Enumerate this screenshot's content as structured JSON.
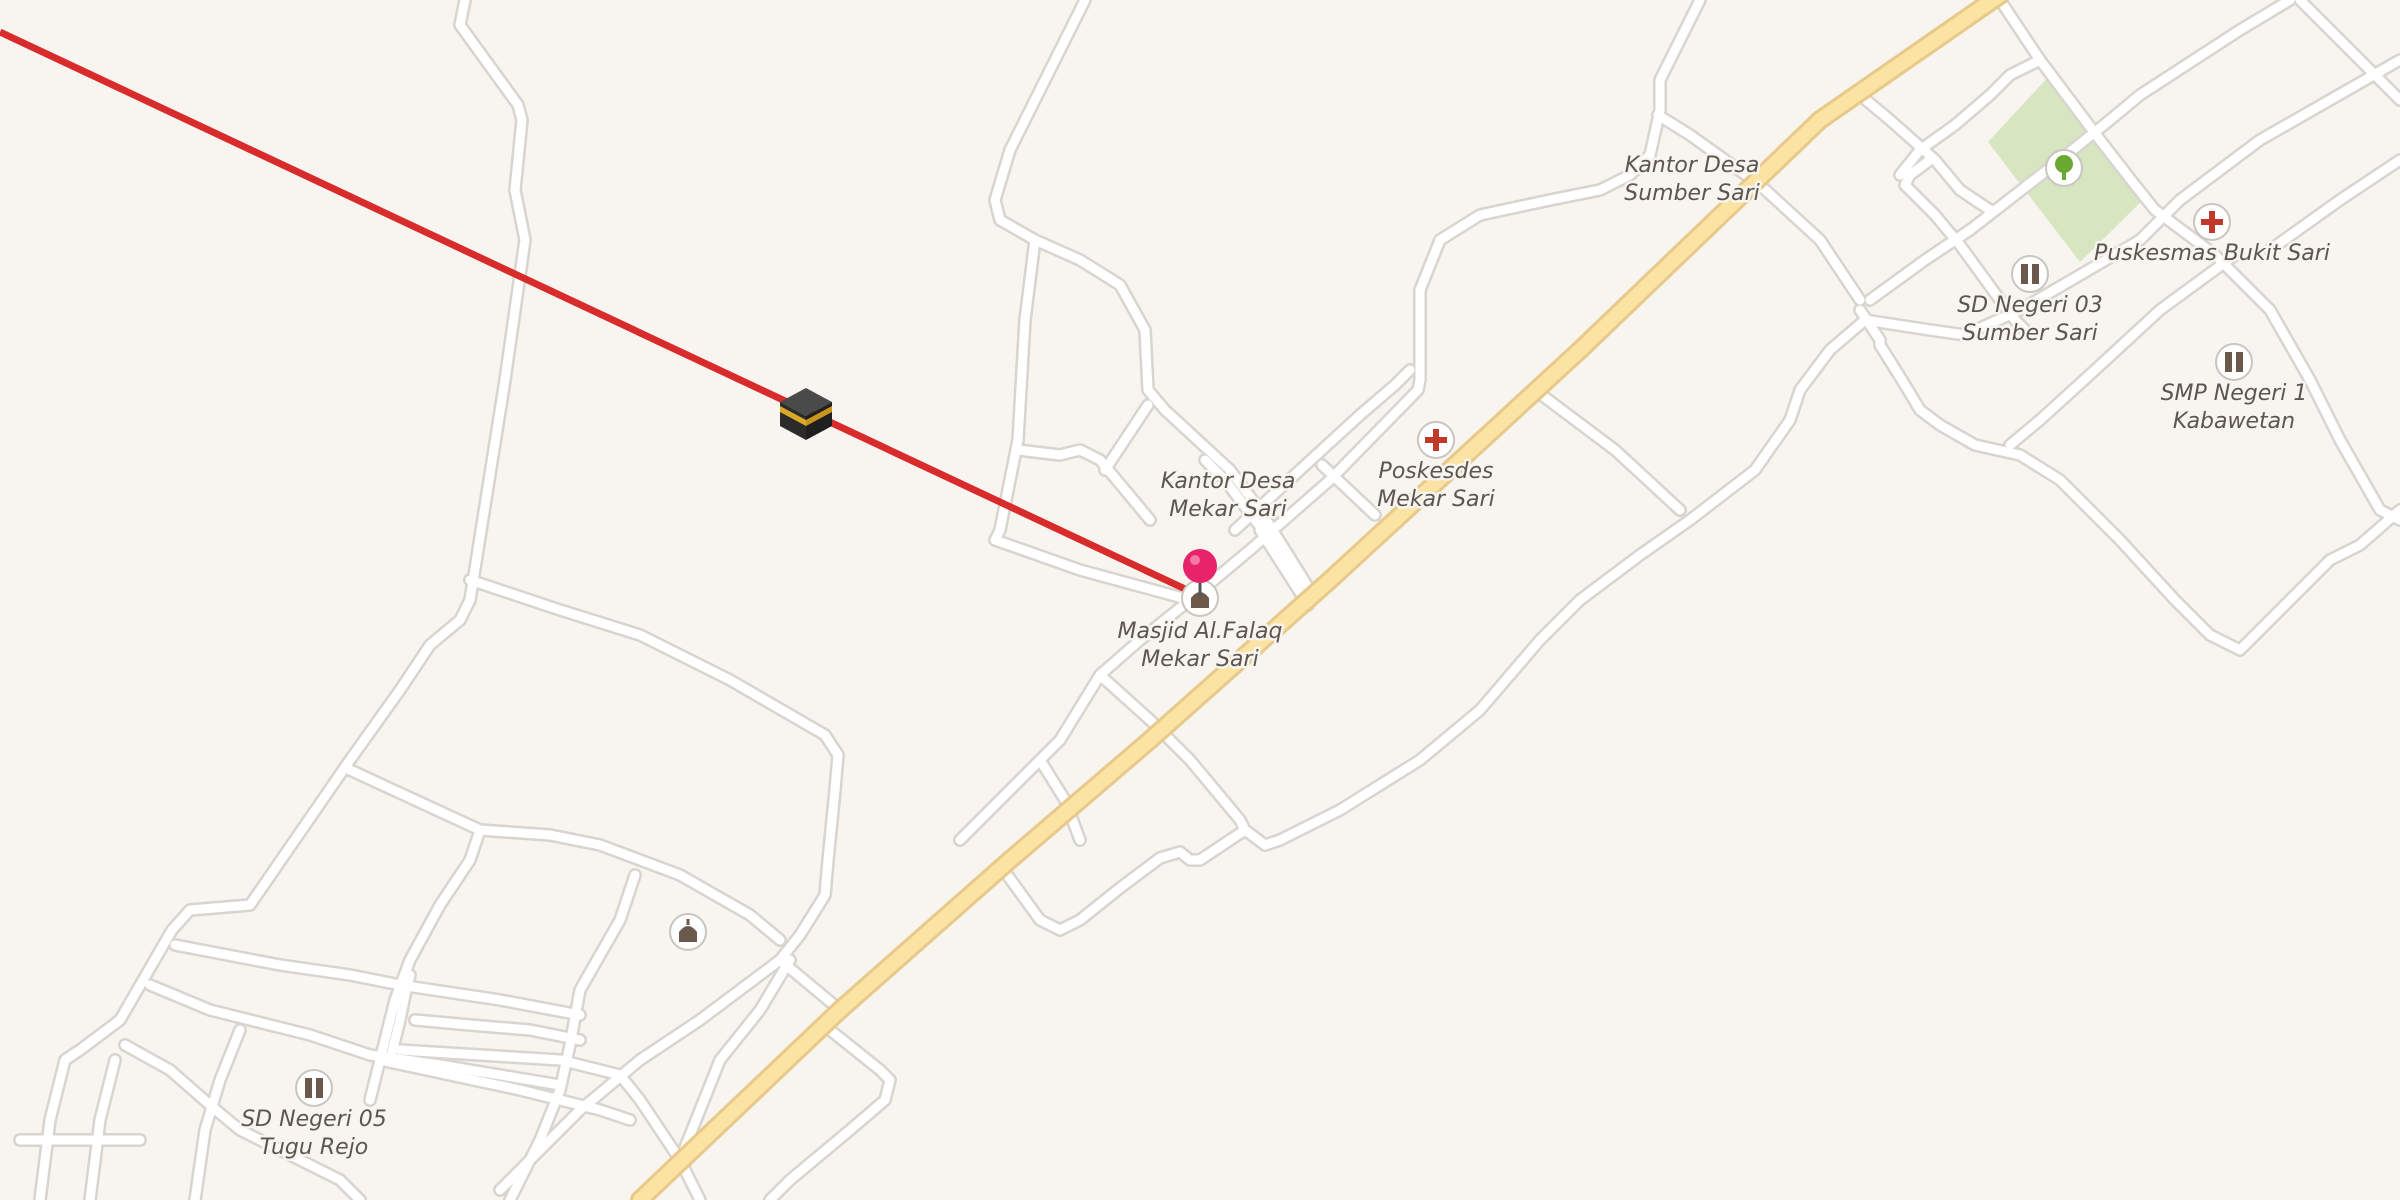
{
  "map": {
    "colors": {
      "land": "#f8f5f1",
      "road": "#ffffff",
      "road_casing": "#d8d4cf",
      "primary_road": "#fbe3a3",
      "park": "#d7e6c1",
      "qibla_line": "#d82b2b",
      "pin": "#e8236a",
      "label_text": "#5b5650"
    },
    "pois": [
      {
        "name": "Kantor Desa",
        "line2": "Sumber Sari",
        "icon": "none"
      },
      {
        "name": "Puskesmas Bukit Sari",
        "line2": "",
        "icon": "hospital-cross-icon"
      },
      {
        "name": "SD Negeri 03",
        "line2": "Sumber Sari",
        "icon": "school-icon"
      },
      {
        "name": "SMP Negeri 1",
        "line2": "Kabawetan",
        "icon": "school-icon"
      },
      {
        "name": "Poskesdes",
        "line2": "Mekar Sari",
        "icon": "hospital-cross-icon"
      },
      {
        "name": "Kantor Desa",
        "line2": "Mekar Sari",
        "icon": "none"
      },
      {
        "name": "Masjid Al.Falaq",
        "line2": "Mekar Sari",
        "icon": "mosque-icon"
      },
      {
        "name": "SD Negeri 05",
        "line2": "Tugu Rejo",
        "icon": "school-icon"
      }
    ],
    "markers": {
      "kaaba": "kaaba-icon",
      "location_pin": "location-pin-icon",
      "park": "tree-icon",
      "unnamed_mosque": "mosque-icon"
    }
  }
}
